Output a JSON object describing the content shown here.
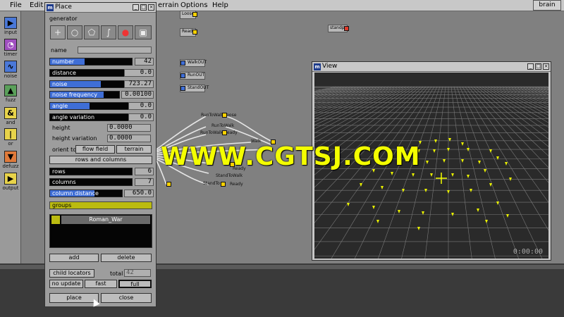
{
  "menubar": {
    "items": [
      "File",
      "Edit",
      "errain",
      "Options",
      "Help"
    ],
    "brain_button": "brain"
  },
  "palette": {
    "tools": [
      {
        "label": "input",
        "icon": "input-arrow-icon",
        "color": "#4a78d8"
      },
      {
        "label": "timer",
        "icon": "timer-icon",
        "color": "#a050c0"
      },
      {
        "label": "noise",
        "icon": "noise-wave-icon",
        "color": "#4a78d8"
      },
      {
        "label": "fuzz",
        "icon": "fuzz-bell-icon",
        "color": "#5aa05a"
      },
      {
        "label": "and",
        "icon": "ampersand-icon",
        "color": "#e8d34a"
      },
      {
        "label": "or",
        "icon": "or-bar-icon",
        "color": "#e8d34a"
      },
      {
        "label": "defuzz",
        "icon": "defuzz-triangle-icon",
        "color": "#e07a3a"
      },
      {
        "label": "output",
        "icon": "output-arrow-icon",
        "color": "#e8d34a"
      }
    ]
  },
  "graph": {
    "nodes": [
      {
        "label": "Loose"
      },
      {
        "label": "Ready"
      },
      {
        "label": "WalkOUT"
      },
      {
        "label": "RunOUT"
      },
      {
        "label": "StandOUT"
      },
      {
        "label": "standpo"
      }
    ],
    "texts": [
      "RunToWalk",
      "Loose",
      "RunToWalk",
      "Ready",
      "RunToWalk",
      "Walk",
      "Ready",
      "StandToWalk",
      "StandTo",
      "Ready"
    ]
  },
  "watermark": "WWW.CGTSJ.COM",
  "place_window": {
    "title": "Place",
    "section": "generator",
    "name_label": "name",
    "name_value": "",
    "sliders_a": [
      {
        "label": "number",
        "value": "42",
        "fill": 0.42
      },
      {
        "label": "distance",
        "value": "0.0",
        "fill": 0.0
      },
      {
        "label": "noise",
        "value": "723.27",
        "fill": 0.62
      },
      {
        "label": "noise frequency",
        "value": "0.00100",
        "fill": 0.78
      },
      {
        "label": "angle",
        "value": "0.0",
        "fill": 0.48
      },
      {
        "label": "angle variation",
        "value": "0.0",
        "fill": 0.0
      }
    ],
    "plain_rows": [
      {
        "label": "height",
        "value": "0.0000"
      },
      {
        "label": "height variation",
        "value": "0.0000"
      }
    ],
    "orient": {
      "label": "orient to",
      "flow_field": "flow field",
      "terrain": "terrain"
    },
    "rows_columns_button": "rows and columns",
    "sliders_b": [
      {
        "label": "rows",
        "value": "6",
        "fill": 0.0
      },
      {
        "label": "columns",
        "value": "7",
        "fill": 0.0
      },
      {
        "label": "column distance",
        "value": "650.0",
        "fill": 0.62
      }
    ],
    "groups_label": "groups",
    "groups": [
      {
        "name": "Roman_War",
        "color": "#bbbb10"
      }
    ],
    "add_button": "add",
    "delete_button": "delete",
    "child_locators_button": "child locators",
    "total_label": "total",
    "total_value": "42",
    "no_update_button": "no update",
    "fast_button": "fast",
    "full_button": "full",
    "place_button": "place",
    "close_button": "close"
  },
  "view_window": {
    "title": "View",
    "timecode": "0:00:00"
  }
}
